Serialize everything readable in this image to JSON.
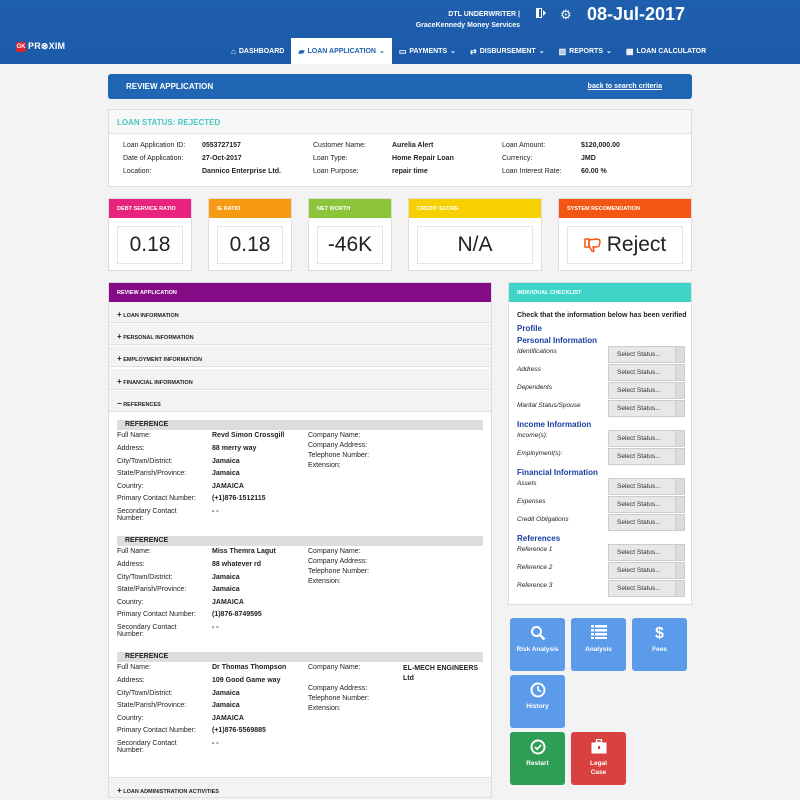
{
  "header": {
    "logo_text": "PR⊗XIM",
    "logo_badge": "GK",
    "user_role": "DTL UNDERWRITER |",
    "user_org": "GraceKennedy Money Services",
    "date": "08-Jul-2017",
    "icons": [
      "door-exit-icon",
      "gear-icon"
    ]
  },
  "nav": {
    "items": [
      {
        "label": "DASHBOARD",
        "icon": "home-icon"
      },
      {
        "label": "LOAN APPLICATION",
        "icon": "folder-icon",
        "active": true
      },
      {
        "label": "PAYMENTS",
        "icon": "card-icon"
      },
      {
        "label": "DISBURSEMENT",
        "icon": "transfer-icon"
      },
      {
        "label": "REPORTS",
        "icon": "chart-icon"
      },
      {
        "label": "LOAN CALCULATOR",
        "icon": "calculator-icon"
      }
    ],
    "caret": "⌄"
  },
  "review_bar": {
    "title": "REVIEW APPLICATION",
    "link": "back to search criteria"
  },
  "loan_status": {
    "title": "LOAN STATUS: REJECTED",
    "col1": [
      {
        "k": "Loan Application ID:",
        "v": "0553727157"
      },
      {
        "k": "Date of Application:",
        "v": "27-Oct-2017"
      },
      {
        "k": "Location:",
        "v": "Dannico Enterprise Ltd."
      }
    ],
    "col2": [
      {
        "k": "Customer Name:",
        "v": "Aurelia Alert"
      },
      {
        "k": "Loan Type:",
        "v": "Home Repair Loan"
      },
      {
        "k": "Loan Purpose:",
        "v": "repair time"
      }
    ],
    "col3": [
      {
        "k": "Loan Amount:",
        "v": "$120,000.00"
      },
      {
        "k": "Currency:",
        "v": "JMD"
      },
      {
        "k": "Loan Interest Rate:",
        "v": "60.00 %"
      }
    ]
  },
  "kpis": [
    {
      "label": "DEBT SERVICE RATIO",
      "value": "0.18",
      "color": "#e8237f"
    },
    {
      "label": "IE RATIO",
      "value": "0.18",
      "color": "#f59a12"
    },
    {
      "label": "NET WORTH",
      "value": "-46K",
      "color": "#8cc43a"
    },
    {
      "label": "CREDIT SCORE",
      "value": "N/A",
      "color": "#f6d000"
    },
    {
      "label": "SYSTEM RECOMENDATION",
      "value": "Reject",
      "color": "#f35612",
      "icon": "thumbs-down-icon"
    }
  ],
  "review_app": {
    "title": "REVIEW APPLICATION",
    "sections": [
      {
        "sign": "+",
        "label": "LOAN INFORMATION"
      },
      {
        "sign": "+",
        "label": "PERSONAL INFORMATION"
      },
      {
        "sign": "+",
        "label": "EMPLOYMENT INFORMATION"
      },
      {
        "sign": "+",
        "label": "FINANCIAL INFORMATION"
      },
      {
        "sign": "−",
        "label": "REFERENCES"
      }
    ],
    "footer_section": {
      "sign": "+",
      "label": "LOAN ADMINISTRATION ACTIVITIES"
    },
    "ref_labels": {
      "header": "REFERENCE",
      "full_name": "Full Name:",
      "address": "Address:",
      "city": "City/Town/District:",
      "state": "State/Parish/Province:",
      "country": "Country:",
      "primary": "Primary Contact Number:",
      "secondary": "Secondary Contact Number:",
      "company_name": "Company Name:",
      "company_address": "Company Address:",
      "telephone": "Telephone Number:",
      "extension": "Extension:"
    },
    "references": [
      {
        "full_name": "Revd Simon Crossgill",
        "address": "88 merry way",
        "city": "Jamaica",
        "state": "Jamaica",
        "country": "JAMAICA",
        "primary": "(+1)876-1512115",
        "secondary": "- -",
        "company": ""
      },
      {
        "full_name": "Miss Themra Lagut",
        "address": "88 whatever rd",
        "city": "Jamaica",
        "state": "Jamaica",
        "country": "JAMAICA",
        "primary": "(1)876-8749595",
        "secondary": "- -",
        "company": ""
      },
      {
        "full_name": "Dr Thomas Thompson",
        "address": "109 Good Game way",
        "city": "Jamaica",
        "state": "Jamaica",
        "country": "JAMAICA",
        "primary": "(+1)876-5569885",
        "secondary": "- -",
        "company": "EL-MECH ENGINEERS Ltd"
      }
    ]
  },
  "checklist": {
    "title": "INDIVIDUAL CHECKLIST",
    "note": "Check that the information below has been verified",
    "profile": "Profile",
    "select_label": "Select Status...",
    "groups": [
      {
        "title": "Personal Information",
        "items": [
          "Identifications",
          "Address",
          "Dependents",
          "Marital Status/Spouse"
        ]
      },
      {
        "title": "Income Information",
        "items": [
          "Income(s):",
          "Employment(s):"
        ]
      },
      {
        "title": "Financial Information",
        "items": [
          "Assets",
          "Expenses",
          "Credit Obligations"
        ]
      },
      {
        "title": "References",
        "items": [
          "Reference 1",
          "Reference 2",
          "Reference 3"
        ]
      }
    ]
  },
  "actions": [
    {
      "label": "Risk Analysis",
      "icon": "search-icon",
      "color": "#5b9bea"
    },
    {
      "label": "Analysis",
      "icon": "list-icon",
      "color": "#5b9bea"
    },
    {
      "label": "Fees",
      "icon": "dollar-icon",
      "color": "#5b9bea"
    },
    {
      "label": "History",
      "icon": "clock-icon",
      "color": "#5b9bea"
    },
    {
      "label": "Restart",
      "icon": "check-circle-icon",
      "color": "#2f9e55"
    },
    {
      "label": "Legal Case",
      "icon": "briefcase-icon",
      "color": "#d94040"
    }
  ]
}
